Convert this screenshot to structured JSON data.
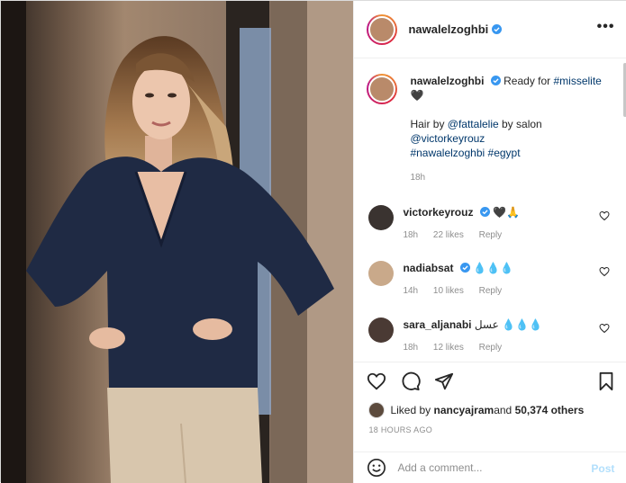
{
  "post": {
    "username": "nawalelzoghbi",
    "caption": {
      "prefix": "Ready for ",
      "hashtag1": "#misselite",
      "heart": "🖤",
      "line2_prefix": "Hair by ",
      "mention1": "@fattalelie",
      "line2_mid": " by salon",
      "mention2": "@victorkeyrouz",
      "hashtag2": "#nawalelzoghbi",
      "hashtag3": "#egypt",
      "age": "18h"
    },
    "comments": [
      {
        "user": "victorkeyrouz",
        "text": "🖤🙏",
        "age": "18h",
        "likes": "22 likes",
        "reply": "Reply",
        "verified": true
      },
      {
        "user": "nadiabsat",
        "text": "💧💧💧",
        "age": "14h",
        "likes": "10 likes",
        "reply": "Reply",
        "verified": true
      },
      {
        "user": "sara_aljanabi",
        "text": "عسل 💧💧💧",
        "age": "18h",
        "likes": "12 likes",
        "reply": "Reply",
        "verified": false
      }
    ],
    "likes": {
      "prefix": "Liked by ",
      "user": "nancyajram",
      "suffix": " and ",
      "others": "50,374 others"
    },
    "timestamp": "18 HOURS AGO",
    "add_comment_placeholder": "Add a comment...",
    "post_label": "Post"
  },
  "colors": {
    "verified": "#3897f0",
    "link": "#00376b",
    "post_disabled": "#b2dffc"
  }
}
